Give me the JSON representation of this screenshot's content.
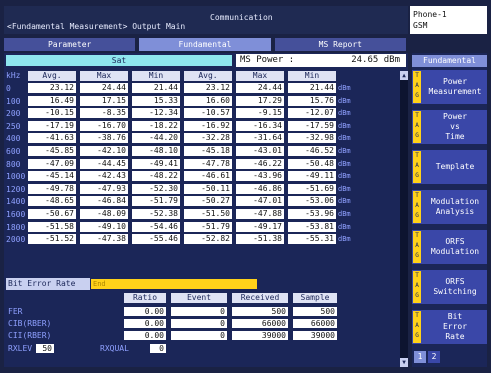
{
  "header": {
    "communication": "Communication",
    "breadcrumb": "<Fundamental Measurement> Output Main",
    "phone_line1": "Phone-1",
    "phone_line2": "GSM"
  },
  "tabs": [
    {
      "label": "Parameter",
      "active": false
    },
    {
      "label": "Fundamental",
      "active": true
    },
    {
      "label": "MS Report",
      "active": false
    }
  ],
  "title": {
    "section": "Sat",
    "ms_power_label": "MS Power :",
    "ms_power_value": "24.65 dBm"
  },
  "table": {
    "col_headers": [
      "Avg.",
      "Max",
      "Min",
      "Avg.",
      "Max",
      "Min"
    ],
    "row_header_label": "kHz",
    "unit": "dBm",
    "rows": [
      {
        "label": "0",
        "values": [
          "23.12",
          "24.44",
          "21.44",
          "23.12",
          "24.44",
          "21.44"
        ]
      },
      {
        "label": "100",
        "values": [
          "16.49",
          "17.15",
          "15.33",
          "16.60",
          "17.29",
          "15.76"
        ]
      },
      {
        "label": "200",
        "values": [
          "-10.15",
          "-8.35",
          "-12.34",
          "-10.57",
          "-9.15",
          "-12.07"
        ]
      },
      {
        "label": "250",
        "values": [
          "-17.19",
          "-16.70",
          "-18.22",
          "-16.92",
          "-16.34",
          "-17.59"
        ]
      },
      {
        "label": "400",
        "values": [
          "-41.63",
          "-38.76",
          "-44.20",
          "-32.28",
          "-31.64",
          "-32.98"
        ]
      },
      {
        "label": "600",
        "values": [
          "-45.85",
          "-42.10",
          "-48.10",
          "-45.18",
          "-43.01",
          "-46.52"
        ]
      },
      {
        "label": "800",
        "values": [
          "-47.09",
          "-44.45",
          "-49.41",
          "-47.78",
          "-46.22",
          "-50.48"
        ]
      },
      {
        "label": "1000",
        "values": [
          "-45.14",
          "-42.43",
          "-48.22",
          "-46.61",
          "-43.96",
          "-49.11"
        ]
      },
      {
        "label": "1200",
        "values": [
          "-49.78",
          "-47.93",
          "-52.30",
          "-50.11",
          "-46.86",
          "-51.69"
        ]
      },
      {
        "label": "1400",
        "values": [
          "-48.65",
          "-46.84",
          "-51.79",
          "-50.27",
          "-47.01",
          "-53.06"
        ]
      },
      {
        "label": "1600",
        "values": [
          "-50.67",
          "-48.09",
          "-52.38",
          "-51.50",
          "-47.88",
          "-53.96"
        ]
      },
      {
        "label": "1800",
        "values": [
          "-51.58",
          "-49.10",
          "-54.46",
          "-51.79",
          "-49.17",
          "-53.81"
        ]
      },
      {
        "label": "2000",
        "values": [
          "-51.52",
          "-47.38",
          "-55.46",
          "-52.82",
          "-51.38",
          "-55.31"
        ]
      }
    ]
  },
  "bit_error": {
    "label": "Bit Error Rate",
    "bar_text": "End",
    "col_headers": [
      "Ratio",
      "Event",
      "Received",
      "Sample"
    ],
    "rows": [
      {
        "label": "FER",
        "values": [
          "0.00",
          "0",
          "500",
          "500"
        ]
      },
      {
        "label": "CIB(RBER)",
        "values": [
          "0.00",
          "0",
          "66000",
          "66000"
        ]
      },
      {
        "label": "CII(RBER)",
        "values": [
          "0.00",
          "0",
          "39000",
          "39000"
        ]
      }
    ],
    "rxlev_label": "RXLEV",
    "rxlev_value": "50",
    "rxqual_label": "RXQUAL",
    "rxqual_value": "0"
  },
  "side_menu": {
    "title": "Fundamental",
    "key_letters": [
      "T",
      "A",
      "G"
    ],
    "buttons": [
      {
        "label": "Power\nMeasurement"
      },
      {
        "label": "Power\nvs\nTime"
      },
      {
        "label": "Template"
      },
      {
        "label": "Modulation\nAnalysis"
      },
      {
        "label": "ORFS\nModulation"
      },
      {
        "label": "ORFS\nSwitching"
      },
      {
        "label": "Bit\nError\nRate"
      }
    ],
    "pages": [
      "1",
      "2"
    ]
  },
  "scroll": {
    "up_glyph": "▲",
    "down_glyph": "▼"
  }
}
